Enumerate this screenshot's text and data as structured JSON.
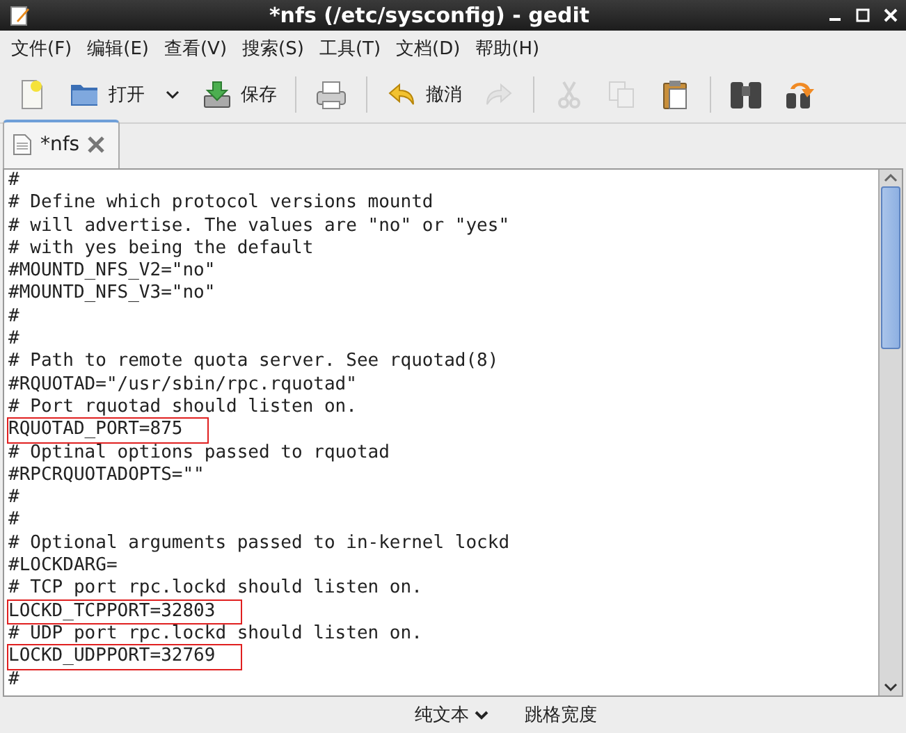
{
  "window": {
    "title": "*nfs (/etc/sysconfig) - gedit"
  },
  "menu": [
    "文件(F)",
    "编辑(E)",
    "查看(V)",
    "搜索(S)",
    "工具(T)",
    "文档(D)",
    "帮助(H)"
  ],
  "toolbar": [
    {
      "kind": "new",
      "disabled": false
    },
    {
      "kind": "open",
      "label": "打开",
      "disabled": false
    },
    {
      "kind": "dropdown",
      "disabled": false
    },
    {
      "kind": "save",
      "label": "保存",
      "disabled": false
    },
    {
      "kind": "sep"
    },
    {
      "kind": "print",
      "disabled": false
    },
    {
      "kind": "sep"
    },
    {
      "kind": "undo",
      "label": "撤消",
      "disabled": false
    },
    {
      "kind": "redo",
      "disabled": true
    },
    {
      "kind": "sep"
    },
    {
      "kind": "cut",
      "disabled": true
    },
    {
      "kind": "copy",
      "disabled": true
    },
    {
      "kind": "paste",
      "disabled": false
    },
    {
      "kind": "sep"
    },
    {
      "kind": "find",
      "disabled": false
    },
    {
      "kind": "replace",
      "disabled": false
    }
  ],
  "tabs": [
    {
      "label": "*nfs",
      "selected": true
    }
  ],
  "lines": [
    {
      "text": "#",
      "highlighted": false
    },
    {
      "text": "# Define which protocol versions mountd",
      "highlighted": false
    },
    {
      "text": "# will advertise. The values are \"no\" or \"yes\"",
      "highlighted": false
    },
    {
      "text": "# with yes being the default",
      "highlighted": false
    },
    {
      "text": "#MOUNTD_NFS_V2=\"no\"",
      "highlighted": false
    },
    {
      "text": "#MOUNTD_NFS_V3=\"no\"",
      "highlighted": false
    },
    {
      "text": "#",
      "highlighted": false
    },
    {
      "text": "#",
      "highlighted": false
    },
    {
      "text": "# Path to remote quota server. See rquotad(8)",
      "highlighted": false
    },
    {
      "text": "#RQUOTAD=\"/usr/sbin/rpc.rquotad\"",
      "highlighted": false
    },
    {
      "text": "# Port rquotad should listen on.",
      "highlighted": false
    },
    {
      "text": "RQUOTAD_PORT=875",
      "highlighted": true
    },
    {
      "text": "# Optinal options passed to rquotad",
      "highlighted": false
    },
    {
      "text": "#RPCRQUOTADOPTS=\"\"",
      "highlighted": false
    },
    {
      "text": "#",
      "highlighted": false
    },
    {
      "text": "#",
      "highlighted": false
    },
    {
      "text": "# Optional arguments passed to in-kernel lockd",
      "highlighted": false
    },
    {
      "text": "#LOCKDARG=",
      "highlighted": false
    },
    {
      "text": "# TCP port rpc.lockd should listen on.",
      "highlighted": false
    },
    {
      "text": "LOCKD_TCPPORT=32803",
      "highlighted": true
    },
    {
      "text": "# UDP port rpc.lockd should listen on.",
      "highlighted": false
    },
    {
      "text": "LOCKD_UDPPORT=32769",
      "highlighted": true
    },
    {
      "text": "#",
      "highlighted": false
    }
  ],
  "status_bar": {
    "language": "纯文本",
    "tab_width": "跳格宽度"
  }
}
